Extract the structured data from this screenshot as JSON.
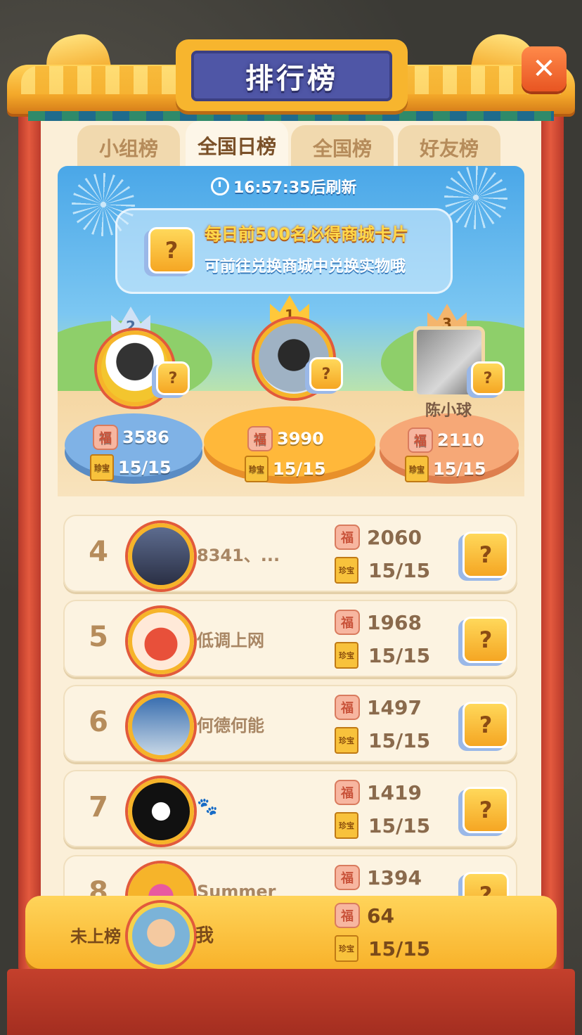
{
  "header": {
    "title": "排行榜",
    "close_icon": "close-icon"
  },
  "tabs": [
    {
      "label": "小组榜",
      "active": false
    },
    {
      "label": "全国日榜",
      "active": true
    },
    {
      "label": "全国榜",
      "active": false
    },
    {
      "label": "好友榜",
      "active": false
    }
  ],
  "refresh": {
    "text": "16:57:35后刷新"
  },
  "promo": {
    "line1": "每日前500名必得商城卡片",
    "line2": "可前往兑换商城中兑换实物哦"
  },
  "podium": {
    "second": {
      "rank": "2",
      "score": "3586",
      "count": "15/15"
    },
    "first": {
      "rank": "1",
      "score": "3990",
      "count": "15/15"
    },
    "third": {
      "rank": "3",
      "name": "陈小球",
      "score": "2110",
      "count": "15/15"
    }
  },
  "list": [
    {
      "rank": "4",
      "name": "8341、...",
      "score": "2060",
      "count": "15/15"
    },
    {
      "rank": "5",
      "name": "低调上网",
      "score": "1968",
      "count": "15/15"
    },
    {
      "rank": "6",
      "name": "何德何能",
      "score": "1497",
      "count": "15/15"
    },
    {
      "rank": "7",
      "name": "🐾",
      "score": "1419",
      "count": "15/15"
    },
    {
      "rank": "8",
      "name": "Summer",
      "score": "1394",
      "count": ""
    }
  ],
  "me": {
    "status": "未上榜",
    "name": "我",
    "score": "64",
    "count": "15/15"
  },
  "icons": {
    "fu": "福",
    "book": "珍宝",
    "mystery": "?"
  },
  "colors": {
    "accent": "#f8b22a",
    "panel": "#fbefd8",
    "title_bg": "#4f56a6",
    "pillar": "#e45a3e"
  }
}
